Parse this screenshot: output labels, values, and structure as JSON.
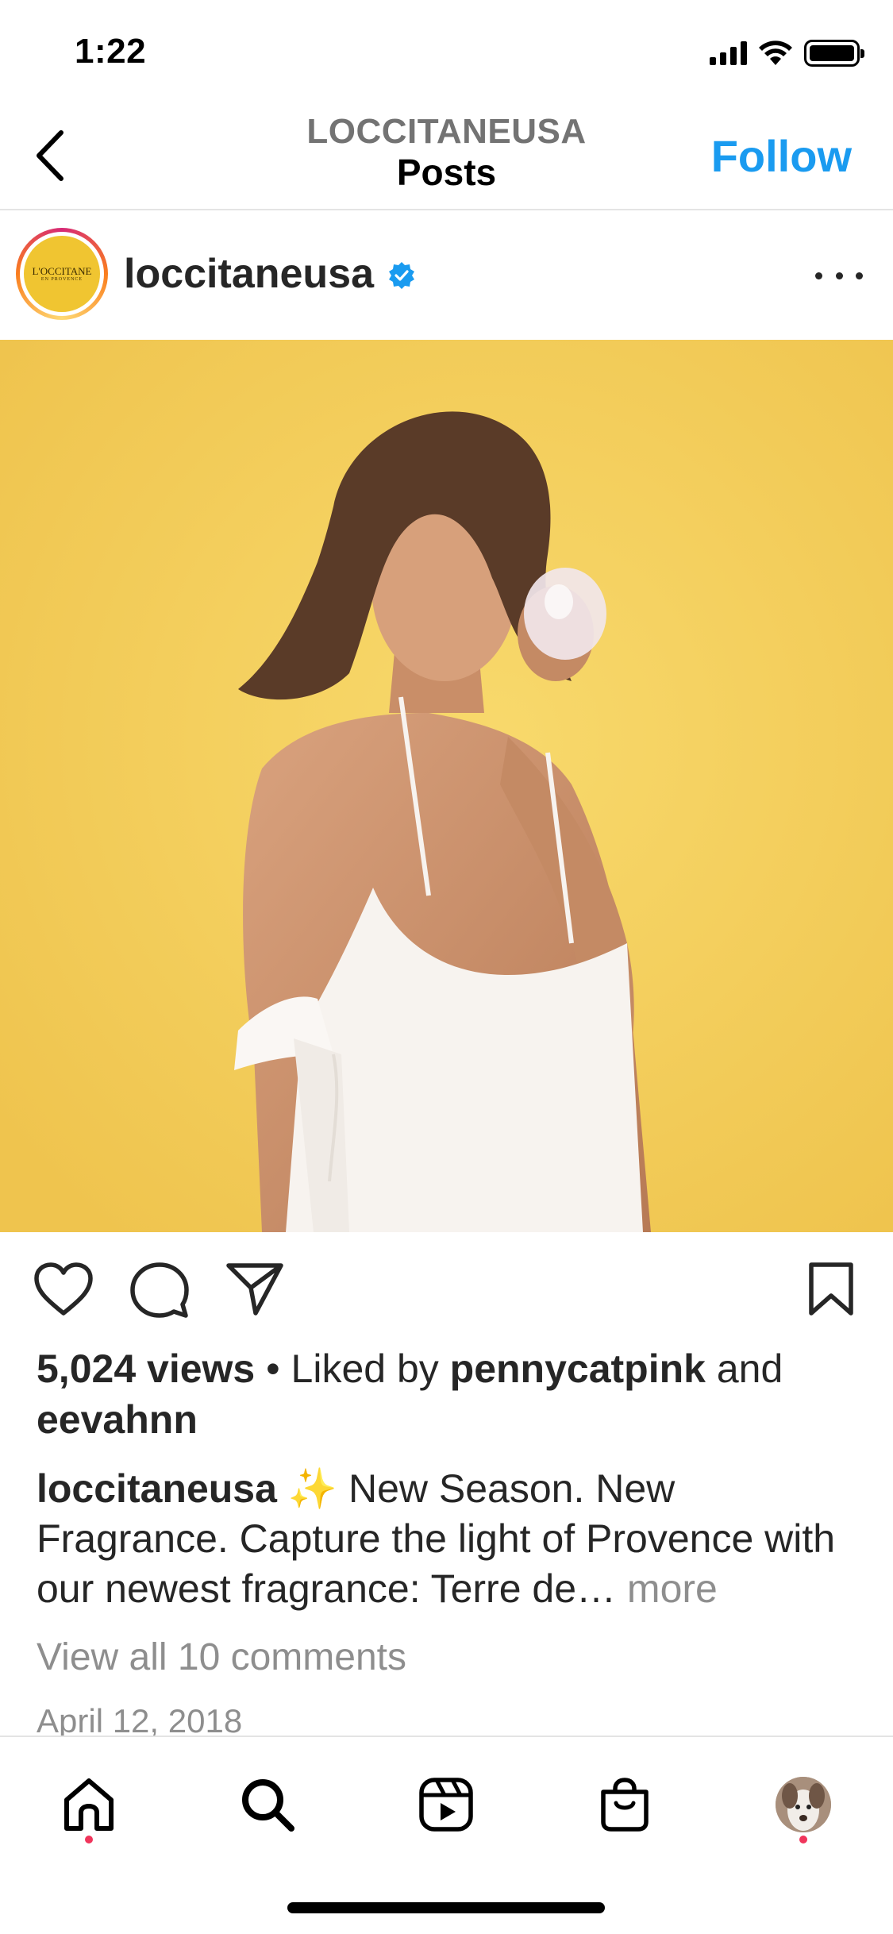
{
  "status_bar": {
    "time": "1:22"
  },
  "nav": {
    "account": "LOCCITANEUSA",
    "section": "Posts",
    "follow_label": "Follow"
  },
  "post": {
    "username": "loccitaneusa",
    "verified": true,
    "avatar_logo": "L'OCCITANE",
    "avatar_logo_sub": "EN PROVENCE",
    "views": "5,024 views",
    "separator": " • ",
    "liked_by_prefix": "Liked by ",
    "liked_by_user": "pennycatpink",
    "liked_by_joiner": " and ",
    "liked_by_other": "eevahnn",
    "caption_user": "loccitaneusa",
    "caption_emoji": "✨",
    "caption_text": "New Season. New Fragrance. Capture the light of Provence with our newest fragrance: Terre de…",
    "more_label": "more",
    "comments_label": "View all 10 comments",
    "date": "April 12, 2018"
  },
  "icons": {
    "back": "chevron-left-icon",
    "more": "ellipsis-icon",
    "like": "heart-icon",
    "comment": "comment-bubble-icon",
    "share": "paper-plane-icon",
    "save": "bookmark-icon",
    "home": "home-icon",
    "search": "search-icon",
    "reels": "reels-icon",
    "shop": "shopping-bag-icon",
    "profile": "profile-avatar"
  },
  "colors": {
    "accent": "#1a9bf0",
    "media_background": "#f3cf5c",
    "notification_dot": "#f0355b",
    "muted_text": "#8e8e8e"
  }
}
